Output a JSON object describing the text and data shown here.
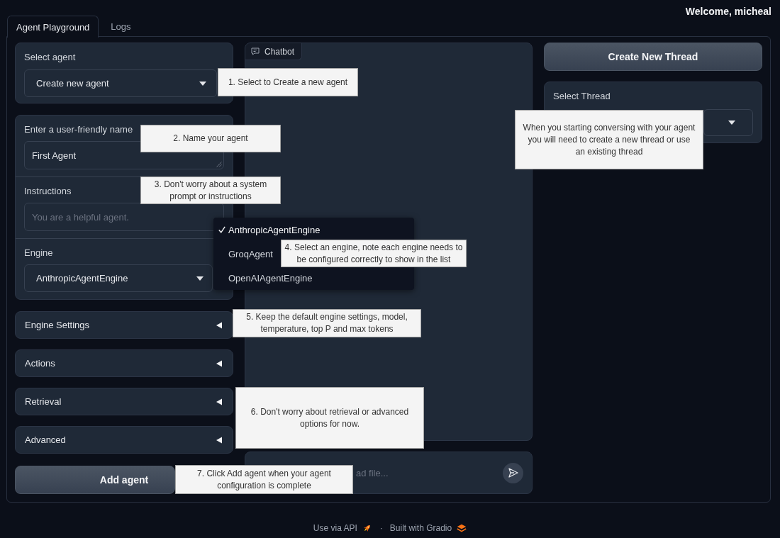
{
  "header": {
    "welcome": "Welcome, micheal"
  },
  "tabs": [
    {
      "label": "Agent Playground",
      "selected": true
    },
    {
      "label": "Logs",
      "selected": false
    }
  ],
  "agent_panel": {
    "select_agent": {
      "label": "Select agent",
      "value": "Create new agent"
    },
    "name_field": {
      "label": "Enter a user-friendly name",
      "value": "First Agent"
    },
    "instructions_field": {
      "label": "Instructions",
      "placeholder": "You are a helpful agent."
    },
    "engine": {
      "label": "Engine",
      "value": "AnthropicAgentEngine",
      "expanded": true,
      "options": [
        {
          "label": "AnthropicAgentEngine",
          "selected": true
        },
        {
          "label": "GroqAgent",
          "selected": false
        },
        {
          "label": "OpenAIAgentEngine",
          "selected": false
        }
      ]
    },
    "accordions": [
      {
        "label": "Engine Settings",
        "expanded": false
      },
      {
        "label": "Actions",
        "expanded": false
      },
      {
        "label": "Retrieval",
        "expanded": false
      },
      {
        "label": "Advanced",
        "expanded": false
      }
    ],
    "add_button": "Add agent"
  },
  "chatbot": {
    "label": "Chatbot",
    "message_input": {
      "placeholder": "ad file..."
    }
  },
  "thread_panel": {
    "create_button": "Create New Thread",
    "select_thread": {
      "label": "Select Thread"
    }
  },
  "callouts": [
    {
      "text": "1. Select to Create a new agent"
    },
    {
      "text": "2. Name your agent"
    },
    {
      "text": "3. Don't worry about a system prompt or instructions"
    },
    {
      "text": "4. Select an engine, note each engine needs to be configured correctly to show in the list"
    },
    {
      "text": "5. Keep the default engine settings, model, temperature, top P and max tokens"
    },
    {
      "text": "6. Don't worry about retrieval or advanced options for now."
    },
    {
      "text": "7. Click Add agent when your agent configuration is complete"
    },
    {
      "text": "When you starting conversing with your agent you will need to create a new thread or use an existing thread"
    }
  ],
  "footer": {
    "api_link": "Use via API",
    "separator": "·",
    "built_with": "Built with Gradio"
  }
}
